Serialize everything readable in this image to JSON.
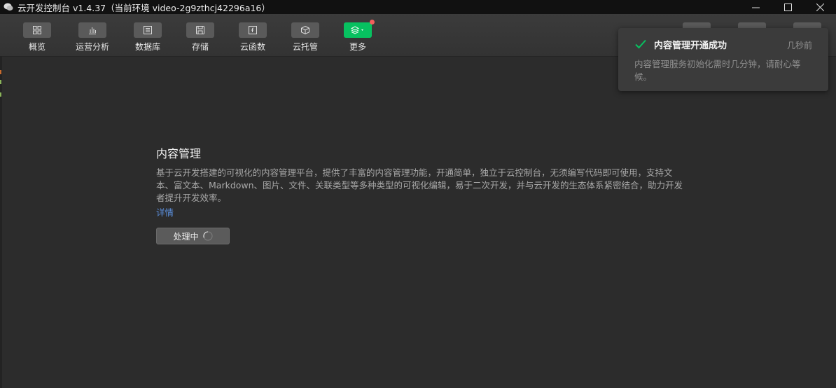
{
  "window": {
    "title": "云开发控制台 v1.4.37（当前环境 video-2g9zthcj42296a16）"
  },
  "toolbar": {
    "items": [
      {
        "label": "概览",
        "icon": "grid-icon"
      },
      {
        "label": "运营分析",
        "icon": "bar-chart-icon"
      },
      {
        "label": "数据库",
        "icon": "database-icon"
      },
      {
        "label": "存储",
        "icon": "save-icon"
      },
      {
        "label": "云函数",
        "icon": "function-icon"
      },
      {
        "label": "云托管",
        "icon": "cube-icon"
      },
      {
        "label": "更多",
        "icon": "layers-icon"
      }
    ]
  },
  "content": {
    "title": "内容管理",
    "description": "基于云开发搭建的可视化的内容管理平台，提供了丰富的内容管理功能，开通简单，独立于云控制台，无须编写代码即可使用，支持文本、富文本、Markdown、图片、文件、关联类型等多种类型的可视化编辑，易于二次开发，并与云开发的生态体系紧密结合，助力开发者提升开发效率。",
    "link": "详情",
    "button": "处理中"
  },
  "toast": {
    "title": "内容管理开通成功",
    "time": "几秒前",
    "message": "内容管理服务初始化需时几分钟，请耐心等候。"
  },
  "colors": {
    "accent": "#07c160",
    "link": "#5b8fdc",
    "notification_dot": "#f25f5c"
  }
}
